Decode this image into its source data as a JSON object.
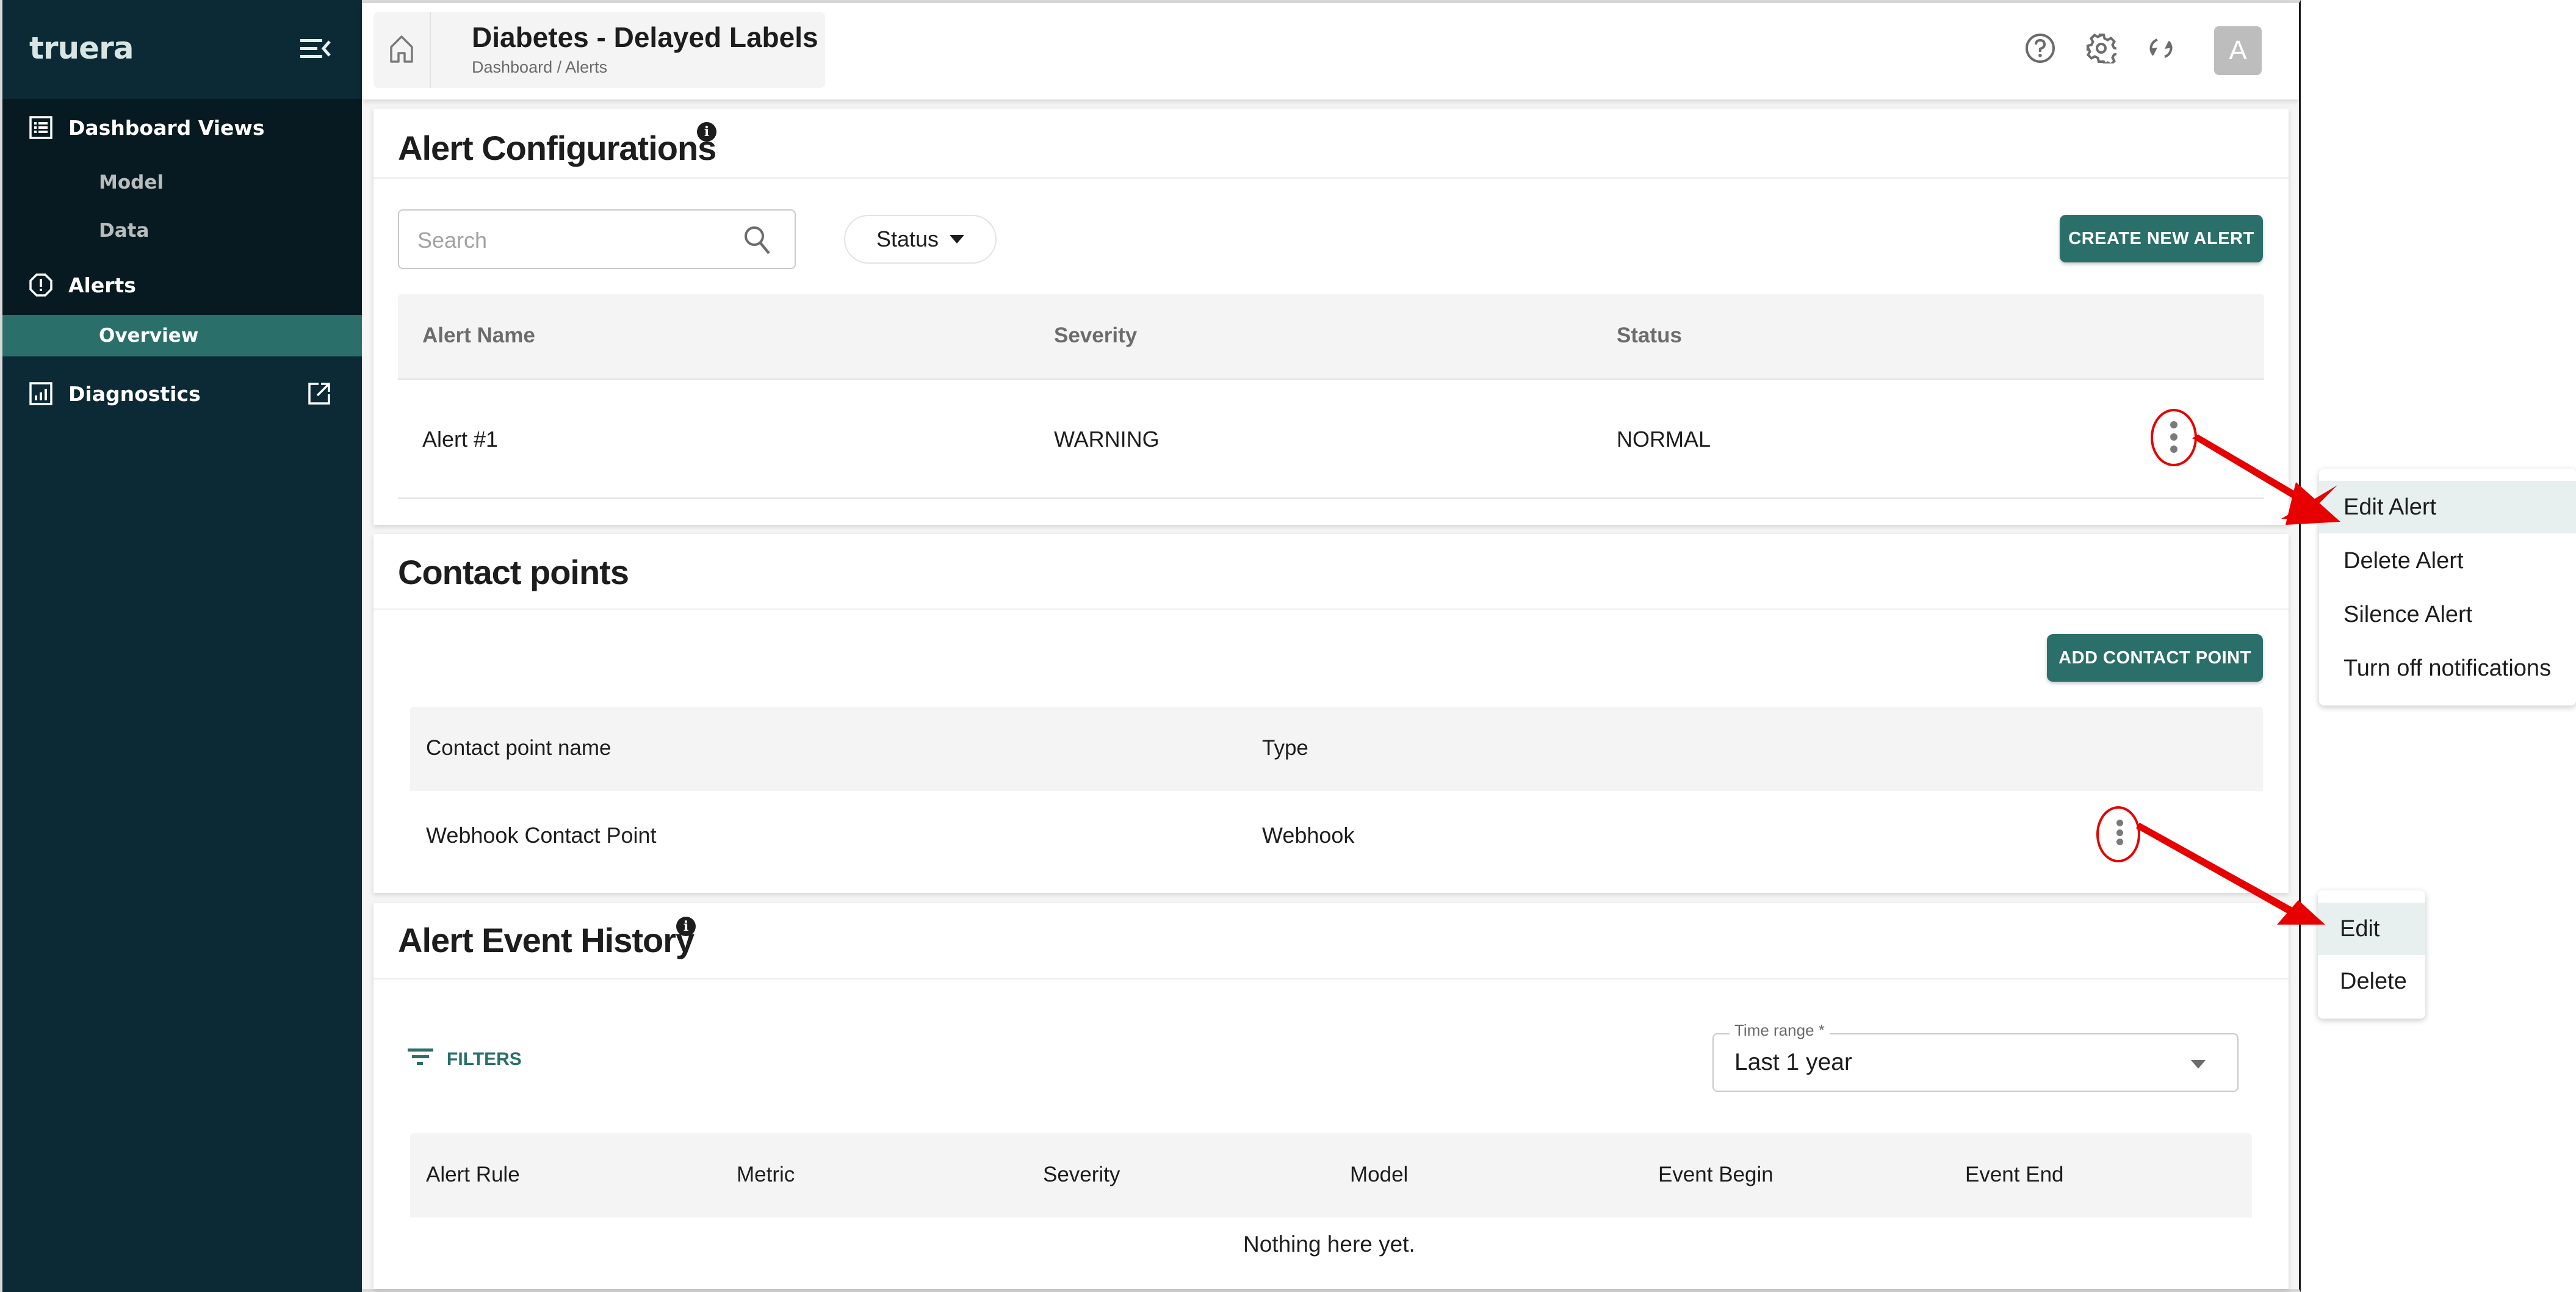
{
  "sidebar": {
    "logo": "truera",
    "items": [
      {
        "label": "Dashboard Views",
        "icon": "list-icon"
      },
      {
        "label": "Model"
      },
      {
        "label": "Data"
      },
      {
        "label": "Alerts",
        "icon": "alert-octagon-icon"
      },
      {
        "label": "Overview",
        "selected": true
      },
      {
        "label": "Diagnostics",
        "icon": "chart-icon",
        "trailing_icon": "external-link-icon"
      }
    ]
  },
  "header": {
    "title": "Diabetes - Delayed Labels",
    "breadcrumb": "Dashboard / Alerts",
    "avatar_initial": "A",
    "icons": [
      "help-icon",
      "settings-icon",
      "refresh-icon"
    ]
  },
  "alert_configurations": {
    "title": "Alert Configurations",
    "info": "i",
    "search_placeholder": "Search",
    "search_value": "",
    "status_filter_label": "Status",
    "create_button": "CREATE NEW ALERT",
    "columns": [
      "Alert Name",
      "Severity",
      "Status"
    ],
    "rows": [
      {
        "name": "Alert #1",
        "severity": "WARNING",
        "status": "NORMAL"
      }
    ]
  },
  "contact_points": {
    "title": "Contact points",
    "add_button": "ADD CONTACT POINT",
    "columns": [
      "Contact point name",
      "Type"
    ],
    "rows": [
      {
        "name": "Webhook Contact Point",
        "type": "Webhook"
      }
    ]
  },
  "alert_event_history": {
    "title": "Alert Event History",
    "info": "i",
    "filters_label": "FILTERS",
    "time_range_label": "Time range *",
    "time_range_value": "Last 1 year",
    "columns": [
      "Alert Rule",
      "Metric",
      "Severity",
      "Model",
      "Event Begin",
      "Event End"
    ],
    "empty_message": "Nothing here yet."
  },
  "alert_menu": {
    "items": [
      "Edit Alert",
      "Delete Alert",
      "Silence Alert",
      "Turn off notifications"
    ],
    "highlighted": "Edit Alert"
  },
  "contact_menu": {
    "items": [
      "Edit",
      "Delete"
    ],
    "highlighted": "Edit"
  },
  "colors": {
    "sidebar_bg": "#0b2a35",
    "nav_bg": "#071a21",
    "accent": "#2b6f6a",
    "annotation": "#e60000",
    "menu_highlight": "#e7f0ef"
  }
}
